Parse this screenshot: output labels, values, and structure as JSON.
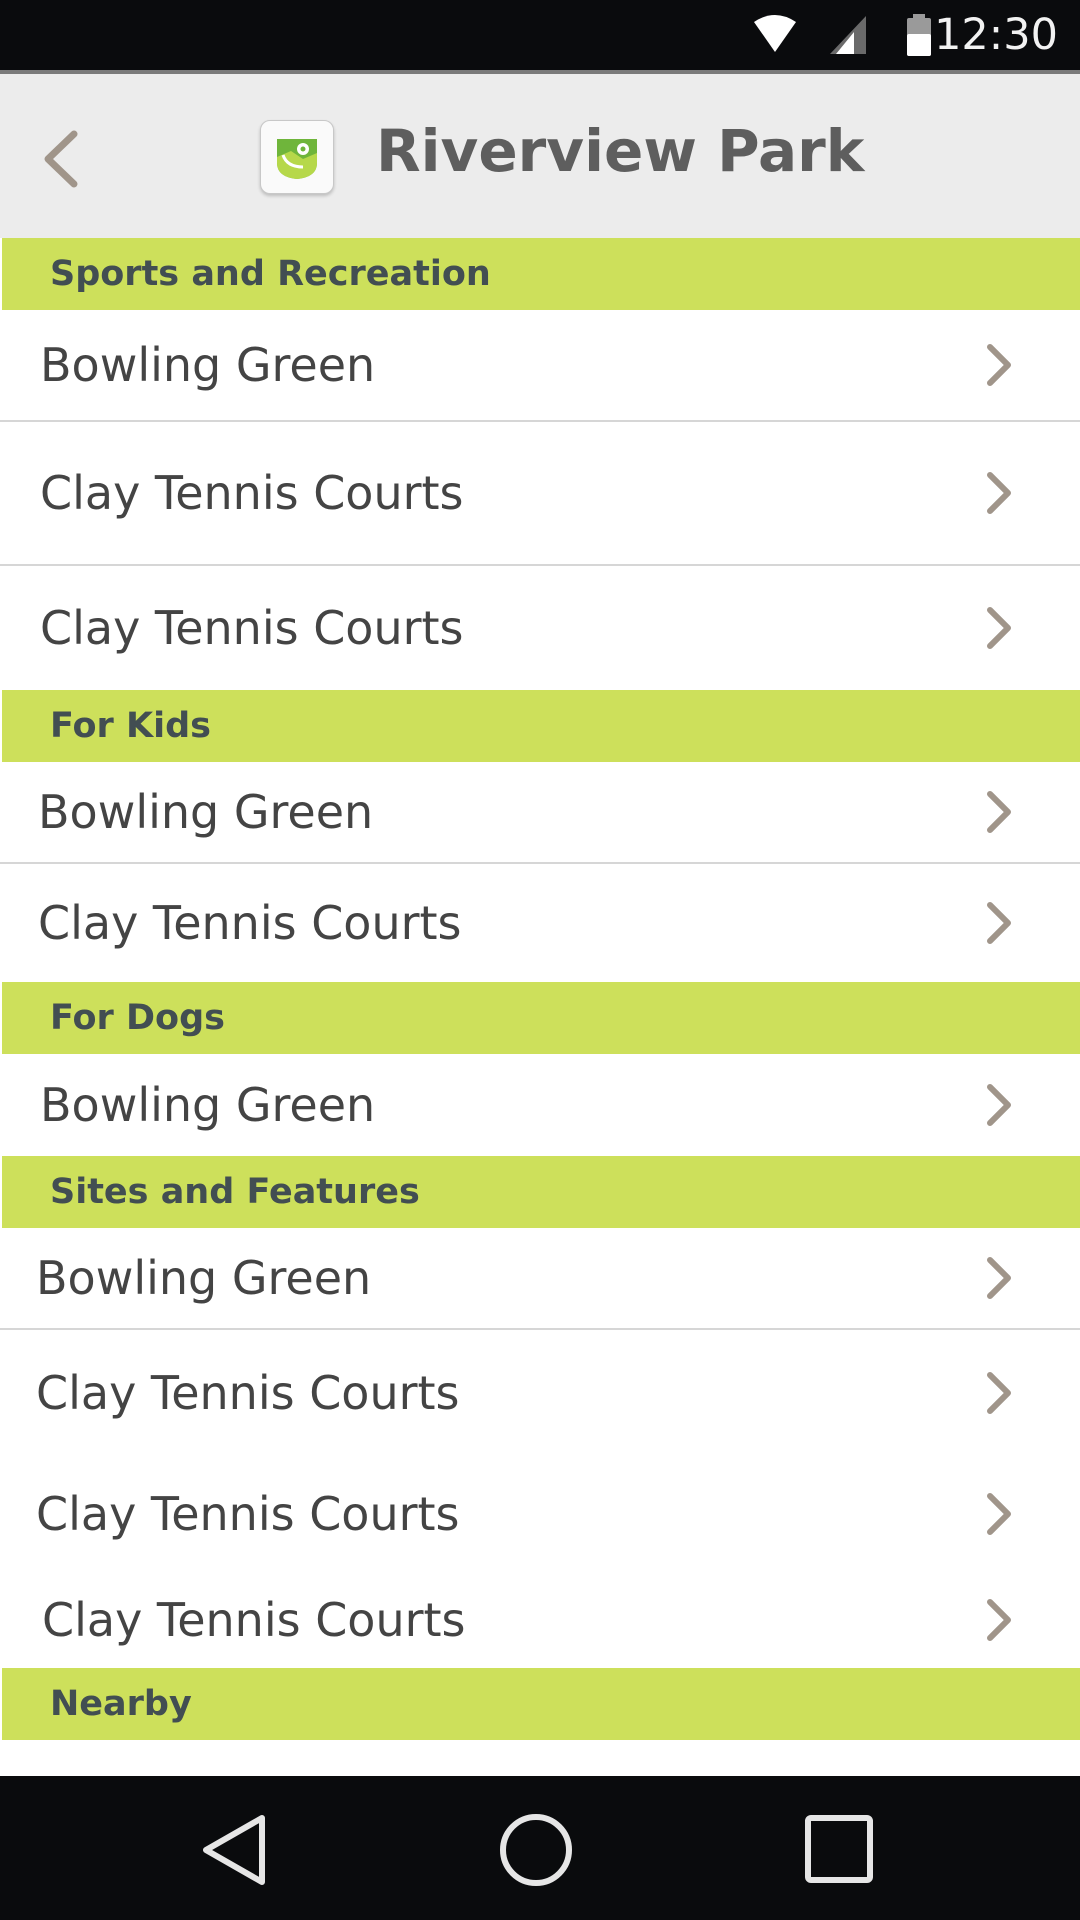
{
  "status_bar": {
    "time": "12:30",
    "icons": [
      "wifi-icon",
      "signal-icon",
      "battery-icon"
    ]
  },
  "header": {
    "title": "Riverview Park",
    "back_icon": "chevron-left-icon",
    "logo_icon": "park-map-logo-icon"
  },
  "sections": [
    {
      "title": "Sports and Recreation",
      "items": [
        "Bowling Green",
        "Clay Tennis Courts",
        "Clay Tennis Courts"
      ]
    },
    {
      "title": "For Kids",
      "items": [
        "Bowling Green",
        "Clay Tennis Courts"
      ]
    },
    {
      "title": "For Dogs",
      "items": [
        "Bowling Green"
      ]
    },
    {
      "title": "Sites and Features",
      "items": [
        "Bowling Green",
        "Clay Tennis Courts",
        "Clay Tennis Courts",
        "Clay Tennis Courts"
      ]
    },
    {
      "title": "Nearby",
      "items": []
    }
  ],
  "nav_bar": {
    "buttons": [
      "back-triangle-icon",
      "home-circle-icon",
      "recents-square-icon"
    ]
  },
  "colors": {
    "section_bg": "#cde05b",
    "section_text": "#424e52",
    "chevron": "#a0958a",
    "header_bg": "#ececec"
  }
}
